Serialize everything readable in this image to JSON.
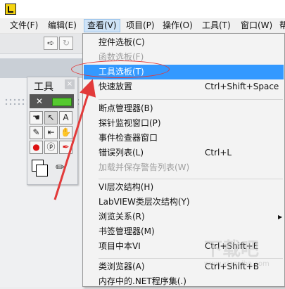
{
  "menubar": {
    "items": [
      "文件(F)",
      "编辑(E)",
      "查看(V)",
      "项目(P)",
      "操作(O)",
      "工具(T)",
      "窗口(W)",
      "帮"
    ],
    "active": "查看(V)"
  },
  "palette": {
    "title": "工具",
    "close": "×"
  },
  "view_menu": {
    "items": [
      {
        "label": "控件选板(C)",
        "shortcut": "",
        "disabled": false
      },
      {
        "label": "函数选板(F)",
        "shortcut": "",
        "disabled": true
      },
      {
        "label": "工具选板(T)",
        "shortcut": "",
        "disabled": false,
        "highlighted": true
      },
      {
        "label": "快速放置",
        "shortcut": "Ctrl+Shift+Space",
        "disabled": false
      },
      {
        "label": "断点管理器(B)",
        "shortcut": "",
        "disabled": false
      },
      {
        "label": "探针监视窗口(P)",
        "shortcut": "",
        "disabled": false
      },
      {
        "label": "事件检查器窗口",
        "shortcut": "",
        "disabled": false
      },
      {
        "label": "错误列表(L)",
        "shortcut": "Ctrl+L",
        "disabled": false
      },
      {
        "label": "加载并保存警告列表(W)",
        "shortcut": "",
        "disabled": true
      },
      {
        "label": "VI层次结构(H)",
        "shortcut": "",
        "disabled": false
      },
      {
        "label": "LabVIEW类层次结构(Y)",
        "shortcut": "",
        "disabled": false
      },
      {
        "label": "浏览关系(R)",
        "shortcut": "",
        "disabled": false,
        "submenu": true
      },
      {
        "label": "书签管理器(M)",
        "shortcut": "",
        "disabled": false
      },
      {
        "label": "项目中本VI",
        "shortcut": "Ctrl+Shift+E",
        "disabled": false
      },
      {
        "label": "类浏览器(A)",
        "shortcut": "Ctrl+Shift+B",
        "disabled": false
      },
      {
        "label": "内存中的.NET程序集(.)",
        "shortcut": "",
        "disabled": false
      }
    ]
  },
  "watermark": {
    "text": "下载吧",
    "sub": "www.xiazaiba.com"
  },
  "colors": {
    "highlight": "#3399ff",
    "annotation": "#e23a3a",
    "menu_active": "#cfe3f7"
  }
}
